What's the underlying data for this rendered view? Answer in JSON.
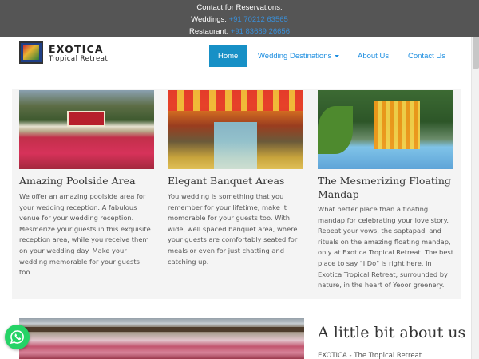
{
  "topbar": {
    "heading": "Contact for Reservations:",
    "weddings_label": "Weddings:",
    "weddings_phone": "+91 70212 63565",
    "restaurant_label": "Restaurant:",
    "restaurant_phone": "+91 83689 26656"
  },
  "brand": {
    "title": "EXOTICA",
    "subtitle": "Tropical Retreat"
  },
  "nav": {
    "items": [
      {
        "label": "Home",
        "active": true
      },
      {
        "label": "Wedding Destinations",
        "has_dropdown": true
      },
      {
        "label": "About Us"
      },
      {
        "label": "Contact Us"
      }
    ]
  },
  "cards": [
    {
      "image": "poolside-venue-photo",
      "title": "Amazing Poolside Area",
      "lines": [
        "We offer an amazing poolside area for",
        "your wedding reception. A fabulous",
        "venue for your wedding reception.",
        "Mesmerize your guests in this exquisite",
        "reception area, while you receive them",
        "on your wedding day. Make your",
        "wedding memorable for your guests",
        "too."
      ]
    },
    {
      "image": "banquet-hall-photo",
      "title": "Elegant Banquet Areas",
      "lines": [
        "You wedding is something that you",
        "remember for your lifetime, make it",
        "momorable for your guests too. With",
        "wide, well spaced banquet area, where",
        "your guests are comfortably seated for",
        "meals or even for just chatting and",
        "catching up."
      ]
    },
    {
      "image": "floating-mandap-photo",
      "title_lines": [
        "The Mesmerizing Floating",
        "Mandap"
      ],
      "lines": [
        "What better place than a floating",
        "mandap for celebrating your love story.",
        "Repeat your vows, the saptapadi and",
        "rituals on the amazing floating mandap,",
        "only at Exotica Tropical Retreat. The best",
        "place to say \"I Do\" is right here, in",
        "Exotica Tropical Retreat, surrounded by",
        "nature, in the heart of Yeoor greenery."
      ]
    }
  ],
  "about": {
    "heading": "A little bit about us",
    "intro": "EXOTICA - The Tropical Retreat"
  },
  "colors": {
    "topbar_bg": "#555555",
    "accent": "#1790c6",
    "link": "#1f8fe0",
    "whatsapp": "#25d366"
  }
}
